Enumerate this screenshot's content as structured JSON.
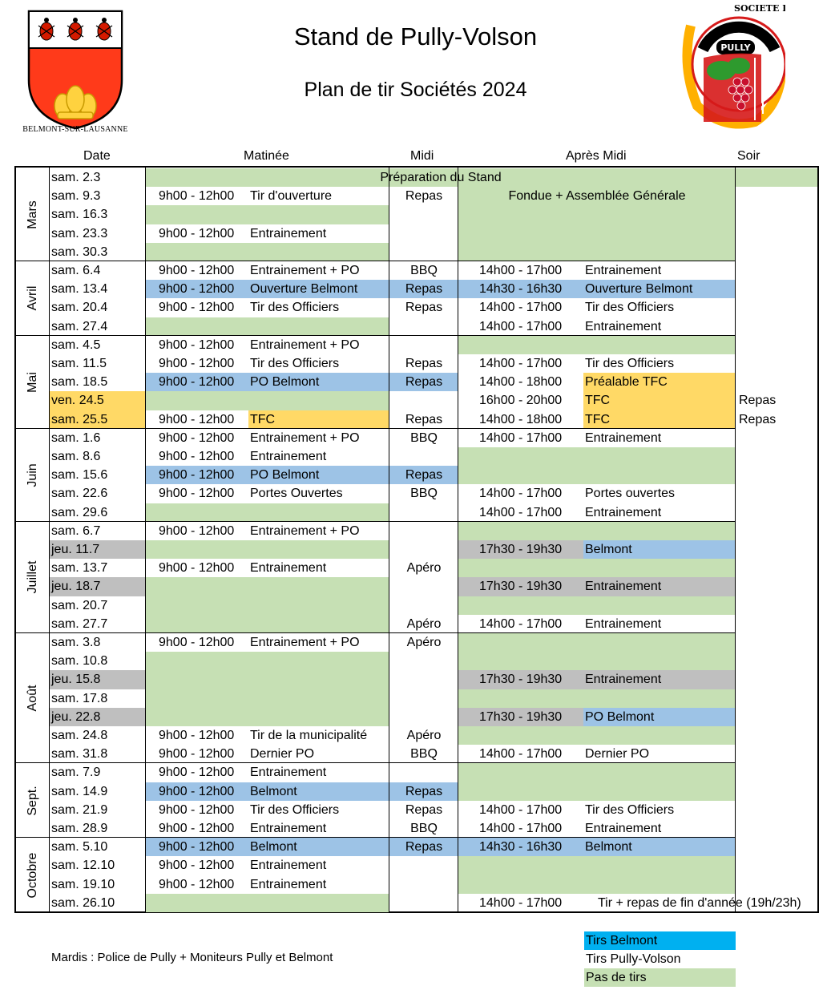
{
  "header": {
    "title": "Stand de Pully-Volson",
    "subtitle": "Plan de tir Sociétés 2024",
    "left_logo_caption": "BELMONT-SUR-LAUSANNE",
    "right_logo_text_ring": "SOCIETE DE TIR DU VOLSON",
    "right_logo_badge": "PULLY"
  },
  "columns": {
    "date": "Date",
    "matinee": "Matinée",
    "midi": "Midi",
    "apres_midi": "Après Midi",
    "soir": "Soir"
  },
  "months": [
    {
      "label": "Mars",
      "rows": 5
    },
    {
      "label": "Avril",
      "rows": 4
    },
    {
      "label": "Mai",
      "rows": 5
    },
    {
      "label": "Juin",
      "rows": 5
    },
    {
      "label": "Juillet",
      "rows": 6
    },
    {
      "label": "Août",
      "rows": 7
    },
    {
      "label": "Sept.",
      "rows": 4
    },
    {
      "label": "Octobre",
      "rows": 4
    }
  ],
  "rows": [
    {
      "date": "sam. 2.3",
      "date_bg": "",
      "am_time": "",
      "am_act": "",
      "am_bg": "green",
      "midi": "",
      "midi_bg": "",
      "pm_time": "",
      "pm_act": "",
      "pm_bg": "green",
      "soir": "",
      "soir_bg": "green",
      "span": "Préparation du Stand"
    },
    {
      "date": "sam. 9.3",
      "date_bg": "",
      "am_time": "9h00 - 12h00",
      "am_act": "Tir d'ouverture",
      "am_bg": "",
      "midi": "Repas",
      "midi_bg": "",
      "pm_time": "",
      "pm_act": "",
      "pm_bg": "green",
      "soir": "",
      "soir_bg": "",
      "pm_center": "Fondue + Assemblée Générale"
    },
    {
      "date": "sam. 16.3",
      "date_bg": "",
      "am_time": "",
      "am_act": "",
      "am_bg": "green",
      "midi": "",
      "midi_bg": "",
      "pm_time": "",
      "pm_act": "",
      "pm_bg": "green",
      "soir": "",
      "soir_bg": ""
    },
    {
      "date": "sam. 23.3",
      "date_bg": "",
      "am_time": "9h00 - 12h00",
      "am_act": "Entrainement",
      "am_bg": "",
      "midi": "",
      "midi_bg": "",
      "pm_time": "",
      "pm_act": "",
      "pm_bg": "green",
      "soir": "",
      "soir_bg": ""
    },
    {
      "date": "sam. 30.3",
      "date_bg": "",
      "am_time": "",
      "am_act": "",
      "am_bg": "green",
      "midi": "",
      "midi_bg": "",
      "pm_time": "",
      "pm_act": "",
      "pm_bg": "green",
      "soir": "",
      "soir_bg": ""
    },
    {
      "date": "sam. 6.4",
      "date_bg": "",
      "am_time": "9h00 - 12h00",
      "am_act": "Entrainement + PO",
      "am_bg": "",
      "midi": "BBQ",
      "midi_bg": "",
      "pm_time": "14h00 - 17h00",
      "pm_act": "Entrainement",
      "pm_bg": "",
      "soir": "",
      "soir_bg": ""
    },
    {
      "date": "sam. 13.4",
      "date_bg": "",
      "am_time": "9h00 - 12h00",
      "am_act": "Ouverture Belmont",
      "am_bg": "blue",
      "midi": "Repas",
      "midi_bg": "blue",
      "pm_time": "14h30 - 16h30",
      "pm_act": "Ouverture Belmont",
      "pm_bg": "blue",
      "soir": "",
      "soir_bg": ""
    },
    {
      "date": "sam. 20.4",
      "date_bg": "",
      "am_time": "9h00 - 12h00",
      "am_act": "Tir des Officiers",
      "am_bg": "",
      "midi": "Repas",
      "midi_bg": "",
      "pm_time": "14h00 - 17h00",
      "pm_act": "Tir des Officiers",
      "pm_bg": "",
      "soir": "",
      "soir_bg": ""
    },
    {
      "date": "sam. 27.4",
      "date_bg": "",
      "am_time": "",
      "am_act": "",
      "am_bg": "green",
      "midi": "",
      "midi_bg": "",
      "pm_time": "14h00 - 17h00",
      "pm_act": "Entrainement",
      "pm_bg": "",
      "soir": "",
      "soir_bg": ""
    },
    {
      "date": "sam. 4.5",
      "date_bg": "",
      "am_time": "9h00 - 12h00",
      "am_act": "Entrainement + PO",
      "am_bg": "",
      "midi": "",
      "midi_bg": "",
      "pm_time": "",
      "pm_act": "",
      "pm_bg": "green",
      "soir": "",
      "soir_bg": ""
    },
    {
      "date": "sam. 11.5",
      "date_bg": "",
      "am_time": "9h00 - 12h00",
      "am_act": "Tir des Officiers",
      "am_bg": "",
      "midi": "Repas",
      "midi_bg": "",
      "pm_time": "14h00 - 17h00",
      "pm_act": "Tir des Officiers",
      "pm_bg": "",
      "soir": "",
      "soir_bg": ""
    },
    {
      "date": "sam. 18.5",
      "date_bg": "",
      "am_time": "9h00 - 12h00",
      "am_act": "PO Belmont",
      "am_bg": "blue",
      "midi": "Repas",
      "midi_bg": "blue",
      "pm_time": "14h00 - 18h00",
      "pm_act": "Préalable TFC",
      "pm_bg": "",
      "pm_act_bg": "yellow",
      "soir": "",
      "soir_bg": ""
    },
    {
      "date": "ven. 24.5",
      "date_bg": "yellow",
      "am_time": "",
      "am_act": "",
      "am_bg": "green",
      "midi": "",
      "midi_bg": "",
      "pm_time": "16h00 - 20h00",
      "pm_act": "TFC",
      "pm_bg": "",
      "pm_act_bg": "yellow",
      "soir": "Repas",
      "soir_bg": ""
    },
    {
      "date": "sam. 25.5",
      "date_bg": "yellow",
      "am_time": "9h00 - 12h00",
      "am_act": "TFC",
      "am_bg": "",
      "am_act_bg": "yellow",
      "midi": "Repas",
      "midi_bg": "",
      "pm_time": "14h00 - 18h00",
      "pm_act": "TFC",
      "pm_bg": "",
      "pm_act_bg": "yellow",
      "soir": "Repas",
      "soir_bg": ""
    },
    {
      "date": "sam. 1.6",
      "date_bg": "",
      "am_time": "9h00 - 12h00",
      "am_act": "Entrainement + PO",
      "am_bg": "",
      "midi": "BBQ",
      "midi_bg": "",
      "pm_time": "14h00 - 17h00",
      "pm_act": "Entrainement",
      "pm_bg": "",
      "soir": "",
      "soir_bg": ""
    },
    {
      "date": "sam. 8.6",
      "date_bg": "",
      "am_time": "9h00 - 12h00",
      "am_act": "Entrainement",
      "am_bg": "",
      "midi": "",
      "midi_bg": "",
      "pm_time": "",
      "pm_act": "",
      "pm_bg": "green",
      "soir": "",
      "soir_bg": ""
    },
    {
      "date": "sam. 15.6",
      "date_bg": "",
      "am_time": "9h00 - 12h00",
      "am_act": "PO Belmont",
      "am_bg": "blue",
      "midi": "Repas",
      "midi_bg": "blue",
      "pm_time": "",
      "pm_act": "",
      "pm_bg": "green",
      "soir": "",
      "soir_bg": ""
    },
    {
      "date": "sam. 22.6",
      "date_bg": "",
      "am_time": "9h00 - 12h00",
      "am_act": "Portes Ouvertes",
      "am_bg": "",
      "midi": "BBQ",
      "midi_bg": "",
      "pm_time": "14h00 - 17h00",
      "pm_act": "Portes ouvertes",
      "pm_bg": "",
      "soir": "",
      "soir_bg": ""
    },
    {
      "date": "sam. 29.6",
      "date_bg": "",
      "am_time": "",
      "am_act": "",
      "am_bg": "green",
      "midi": "",
      "midi_bg": "",
      "pm_time": "14h00 - 17h00",
      "pm_act": "Entrainement",
      "pm_bg": "",
      "soir": "",
      "soir_bg": ""
    },
    {
      "date": "sam. 6.7",
      "date_bg": "",
      "am_time": "9h00 - 12h00",
      "am_act": "Entrainement + PO",
      "am_bg": "",
      "midi": "",
      "midi_bg": "",
      "pm_time": "",
      "pm_act": "",
      "pm_bg": "green",
      "soir": "",
      "soir_bg": ""
    },
    {
      "date": "jeu. 11.7",
      "date_bg": "gray",
      "am_time": "",
      "am_act": "",
      "am_bg": "green",
      "midi": "",
      "midi_bg": "",
      "pm_time": "17h30 - 19h30",
      "pm_act": "Belmont",
      "pm_bg": "gray",
      "pm_act_bg": "blue",
      "soir": "",
      "soir_bg": ""
    },
    {
      "date": "sam. 13.7",
      "date_bg": "",
      "am_time": "9h00 - 12h00",
      "am_act": "Entrainement",
      "am_bg": "",
      "midi": "Apéro",
      "midi_bg": "",
      "pm_time": "",
      "pm_act": "",
      "pm_bg": "green",
      "soir": "",
      "soir_bg": ""
    },
    {
      "date": "jeu. 18.7",
      "date_bg": "gray",
      "am_time": "",
      "am_act": "",
      "am_bg": "green",
      "midi": "",
      "midi_bg": "",
      "pm_time": "17h30 - 19h30",
      "pm_act": "Entrainement",
      "pm_bg": "gray",
      "soir": "",
      "soir_bg": ""
    },
    {
      "date": "sam. 20.7",
      "date_bg": "",
      "am_time": "",
      "am_act": "",
      "am_bg": "green",
      "midi": "",
      "midi_bg": "",
      "pm_time": "",
      "pm_act": "",
      "pm_bg": "green",
      "soir": "",
      "soir_bg": ""
    },
    {
      "date": "sam. 27.7",
      "date_bg": "",
      "am_time": "",
      "am_act": "",
      "am_bg": "green",
      "midi": "Apéro",
      "midi_bg": "",
      "pm_time": "14h00 - 17h00",
      "pm_act": "Entrainement",
      "pm_bg": "",
      "soir": "",
      "soir_bg": ""
    },
    {
      "date": "sam. 3.8",
      "date_bg": "",
      "am_time": "9h00 - 12h00",
      "am_act": "Entrainement + PO",
      "am_bg": "",
      "midi": "Apéro",
      "midi_bg": "",
      "pm_time": "",
      "pm_act": "",
      "pm_bg": "green",
      "soir": "",
      "soir_bg": ""
    },
    {
      "date": "sam. 10.8",
      "date_bg": "",
      "am_time": "",
      "am_act": "",
      "am_bg": "green",
      "midi": "",
      "midi_bg": "",
      "pm_time": "",
      "pm_act": "",
      "pm_bg": "green",
      "soir": "",
      "soir_bg": ""
    },
    {
      "date": "jeu. 15.8",
      "date_bg": "gray",
      "am_time": "",
      "am_act": "",
      "am_bg": "green",
      "midi": "",
      "midi_bg": "",
      "pm_time": "17h30 - 19h30",
      "pm_act": "Entrainement",
      "pm_bg": "gray",
      "soir": "",
      "soir_bg": ""
    },
    {
      "date": "sam. 17.8",
      "date_bg": "",
      "am_time": "",
      "am_act": "",
      "am_bg": "green",
      "midi": "",
      "midi_bg": "",
      "pm_time": "",
      "pm_act": "",
      "pm_bg": "green",
      "soir": "",
      "soir_bg": ""
    },
    {
      "date": "jeu. 22.8",
      "date_bg": "gray",
      "am_time": "",
      "am_act": "",
      "am_bg": "green",
      "midi": "",
      "midi_bg": "",
      "pm_time": "17h30 - 19h30",
      "pm_act": "PO Belmont",
      "pm_bg": "gray",
      "pm_act_bg": "blue",
      "soir": "",
      "soir_bg": ""
    },
    {
      "date": "sam. 24.8",
      "date_bg": "",
      "am_time": "9h00 - 12h00",
      "am_act": "Tir de la municipalité",
      "am_bg": "",
      "midi": "Apéro",
      "midi_bg": "",
      "pm_time": "",
      "pm_act": "",
      "pm_bg": "green",
      "soir": "",
      "soir_bg": ""
    },
    {
      "date": "sam. 31.8",
      "date_bg": "",
      "am_time": "9h00 - 12h00",
      "am_act": "Dernier PO",
      "am_bg": "",
      "midi": "BBQ",
      "midi_bg": "",
      "pm_time": "14h00 - 17h00",
      "pm_act": "Dernier PO",
      "pm_bg": "",
      "soir": "",
      "soir_bg": ""
    },
    {
      "date": "sam. 7.9",
      "date_bg": "",
      "am_time": "9h00 - 12h00",
      "am_act": "Entrainement",
      "am_bg": "",
      "midi": "",
      "midi_bg": "",
      "pm_time": "",
      "pm_act": "",
      "pm_bg": "green",
      "soir": "",
      "soir_bg": ""
    },
    {
      "date": "sam. 14.9",
      "date_bg": "",
      "am_time": "9h00 - 12h00",
      "am_act": "Belmont",
      "am_bg": "blue",
      "midi": "Repas",
      "midi_bg": "blue",
      "pm_time": "",
      "pm_act": "",
      "pm_bg": "green",
      "soir": "",
      "soir_bg": ""
    },
    {
      "date": "sam. 21.9",
      "date_bg": "",
      "am_time": "9h00 - 12h00",
      "am_act": "Tir des Officiers",
      "am_bg": "",
      "midi": "Repas",
      "midi_bg": "",
      "pm_time": "14h00 - 17h00",
      "pm_act": "Tir des Officiers",
      "pm_bg": "",
      "soir": "",
      "soir_bg": ""
    },
    {
      "date": "sam. 28.9",
      "date_bg": "",
      "am_time": "9h00 - 12h00",
      "am_act": "Entrainement",
      "am_bg": "",
      "midi": "BBQ",
      "midi_bg": "",
      "pm_time": "14h00 - 17h00",
      "pm_act": "Entrainement",
      "pm_bg": "",
      "soir": "",
      "soir_bg": ""
    },
    {
      "date": "sam. 5.10",
      "date_bg": "",
      "am_time": "9h00 - 12h00",
      "am_act": "Belmont",
      "am_bg": "blue",
      "midi": "Repas",
      "midi_bg": "blue",
      "pm_time": "14h30 - 16h30",
      "pm_act": "Belmont",
      "pm_bg": "blue",
      "soir": "",
      "soir_bg": ""
    },
    {
      "date": "sam. 12.10",
      "date_bg": "",
      "am_time": "9h00 - 12h00",
      "am_act": "Entrainement",
      "am_bg": "",
      "midi": "",
      "midi_bg": "",
      "pm_time": "",
      "pm_act": "",
      "pm_bg": "green",
      "soir": "",
      "soir_bg": ""
    },
    {
      "date": "sam. 19.10",
      "date_bg": "",
      "am_time": "9h00 - 12h00",
      "am_act": "Entrainement",
      "am_bg": "",
      "midi": "",
      "midi_bg": "",
      "pm_time": "",
      "pm_act": "",
      "pm_bg": "green",
      "soir": "",
      "soir_bg": ""
    },
    {
      "date": "sam. 26.10",
      "date_bg": "",
      "am_time": "",
      "am_act": "",
      "am_bg": "green",
      "midi": "",
      "midi_bg": "",
      "pm_time": "14h00 - 17h00",
      "pm_act": "",
      "pm_bg": "",
      "soir": "",
      "soir_bg": "",
      "pm_wide": "Tir + repas de fin d'année (19h/23h)"
    }
  ],
  "footer": {
    "note": "Mardis : Police de Pully + Moniteurs Pully et Belmont"
  },
  "legend": [
    {
      "label": "Tirs Belmont",
      "color": "#00b0f0"
    },
    {
      "label": "Tirs Pully-Volson",
      "color": "#ffffff"
    },
    {
      "label": "Pas de tirs",
      "color": "#c6e0b4"
    }
  ]
}
